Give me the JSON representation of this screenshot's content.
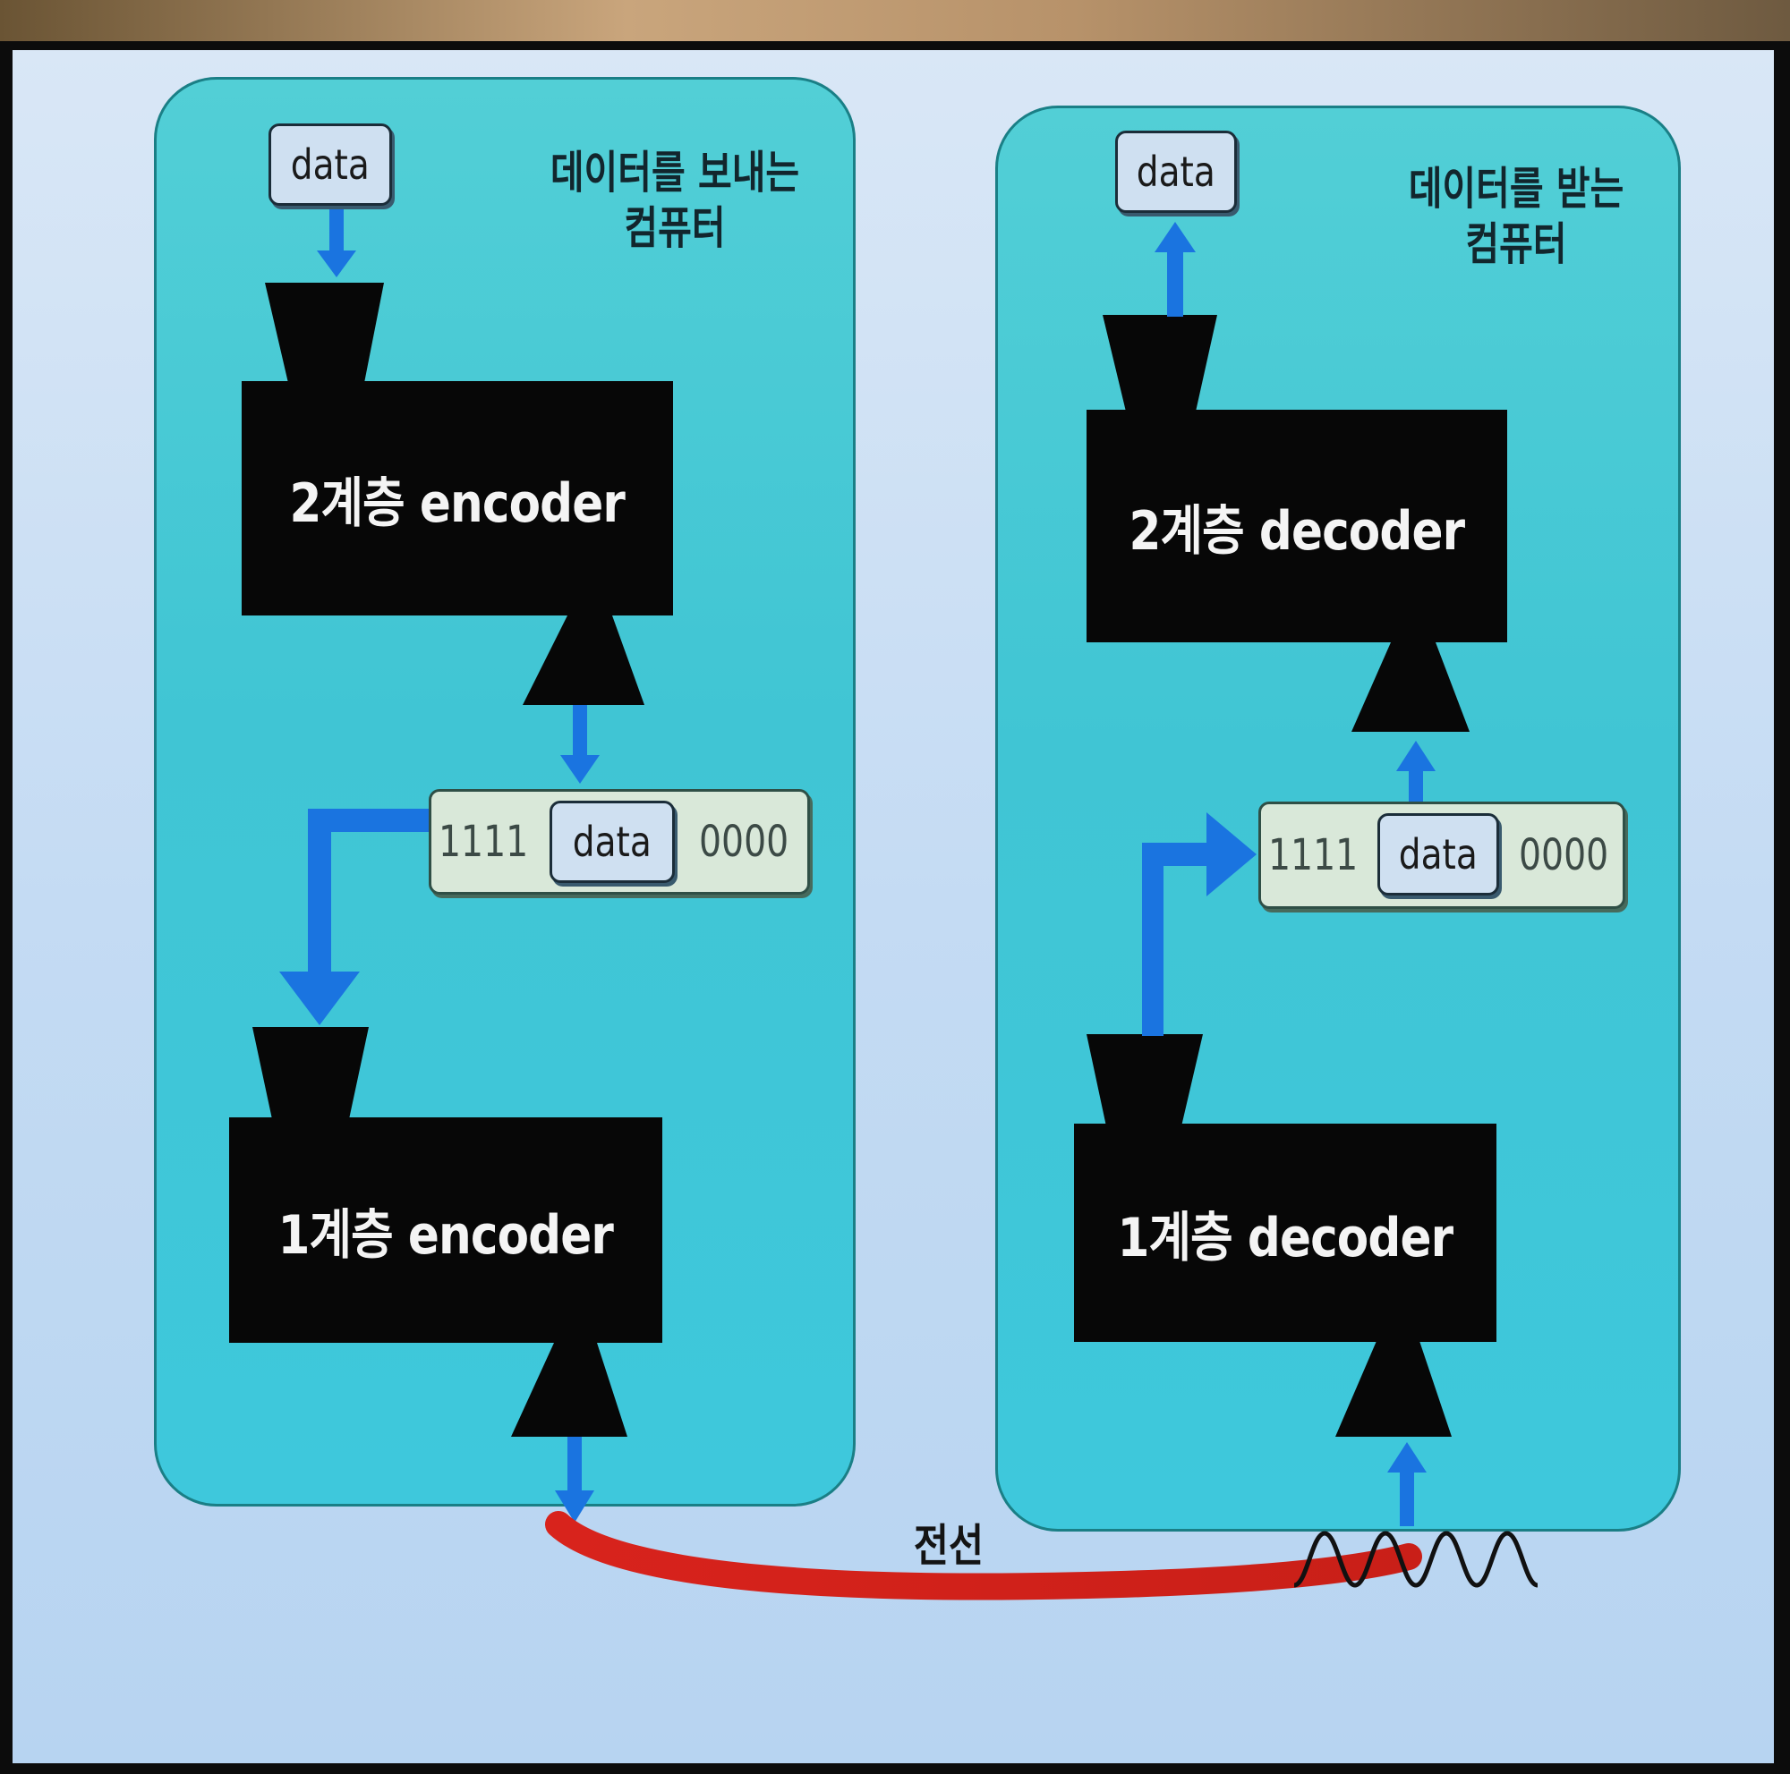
{
  "sender": {
    "caption": "데이터를 보내는\n컴퓨터",
    "data_label": "data",
    "layer2_label": "2계층 encoder",
    "frame": {
      "header": "1111",
      "data": "data",
      "trailer": "0000"
    },
    "layer1_label": "1계층 encoder"
  },
  "receiver": {
    "caption": "데이터를 받는\n컴퓨터",
    "data_label": "data",
    "layer2_label": "2계층 decoder",
    "frame": {
      "header": "1111",
      "data": "data",
      "trailer": "0000"
    },
    "layer1_label": "1계층 decoder"
  },
  "wire": {
    "label": "전선"
  },
  "colors": {
    "panel": "#43c8d6",
    "block": "#070707",
    "arrow": "#1a74e0",
    "wire": "#d8231c",
    "signal": "#111111"
  }
}
